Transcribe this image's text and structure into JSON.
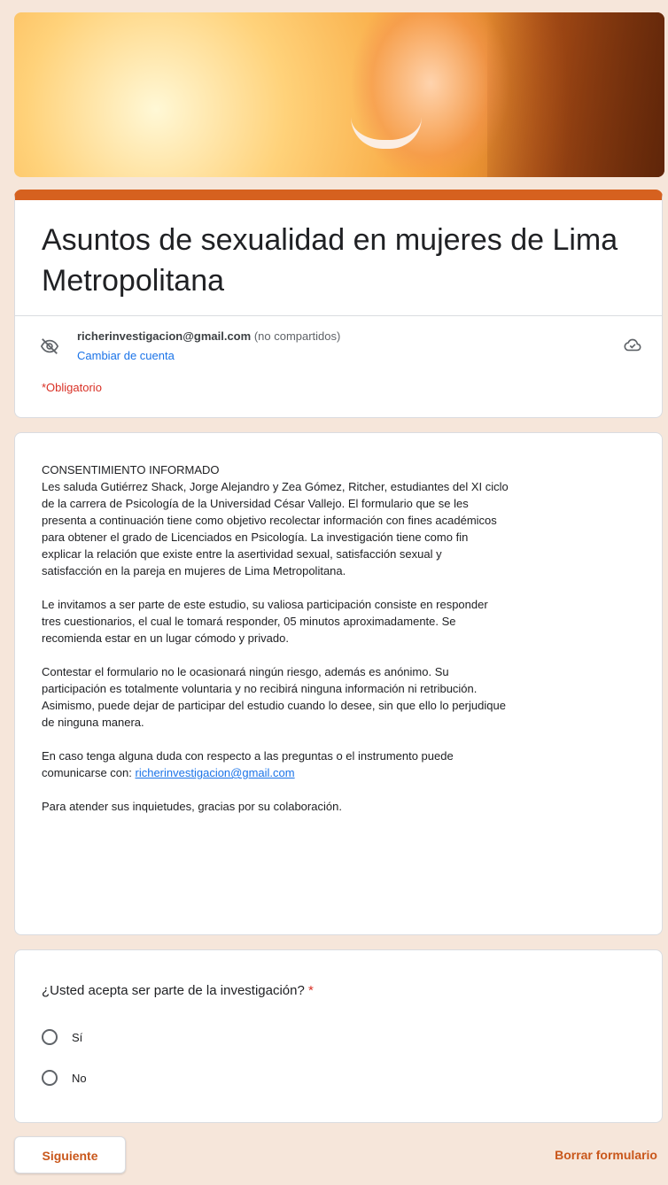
{
  "banner": {
    "image": "smiling-woman-sunset-photo"
  },
  "header": {
    "title": "Asuntos de sexualidad en mujeres de Lima Metropolitana",
    "account_email": "richerinvestigacion@gmail.com",
    "account_note": "(no compartidos)",
    "switch_account": "Cambiar de cuenta",
    "required_note": "*Obligatorio",
    "accent_color": "#d6611f"
  },
  "info": {
    "heading": "CONSENTIMIENTO INFORMADO",
    "paragraph1": "Les saluda Gutiérrez Shack, Jorge Alejandro y Zea Gómez, Ritcher, estudiantes del XI ciclo\nde la carrera de Psicología de la Universidad César Vallejo. El formulario que se les\npresenta a continuación tiene como objetivo recolectar información con fines académicos\npara obtener el grado de Licenciados en Psicología. La investigación tiene como fin\nexplicar la relación que existe entre la asertividad sexual, satisfacción sexual y\nsatisfacción en la pareja en mujeres de Lima Metropolitana.",
    "paragraph2": "Le invitamos a ser parte de este estudio, su valiosa participación consiste en responder\ntres cuestionarios, el cual le tomará responder, 05 minutos aproximadamente. Se\nrecomienda estar en un lugar cómodo y privado.",
    "paragraph3": "Contestar el formulario no le ocasionará ningún riesgo, además es anónimo. Su\nparticipación es totalmente voluntaria y no recibirá ninguna información ni retribución.\nAsimismo, puede dejar de participar del estudio cuando lo desee, sin que ello lo perjudique\nde ninguna manera.",
    "paragraph4_prefix": "En caso tenga alguna duda con respecto a las preguntas o el instrumento puede\ncomunicarse con: ",
    "contact_email": "richerinvestigacion@gmail.com",
    "paragraph5": "Para atender sus inquietudes, gracias por su colaboración."
  },
  "question": {
    "label": "¿Usted acepta ser parte de la investigación?",
    "required_mark": "*",
    "options": [
      {
        "label": "Sí"
      },
      {
        "label": "No"
      }
    ]
  },
  "footer": {
    "next_label": "Siguiente",
    "clear_label": "Borrar formulario"
  }
}
